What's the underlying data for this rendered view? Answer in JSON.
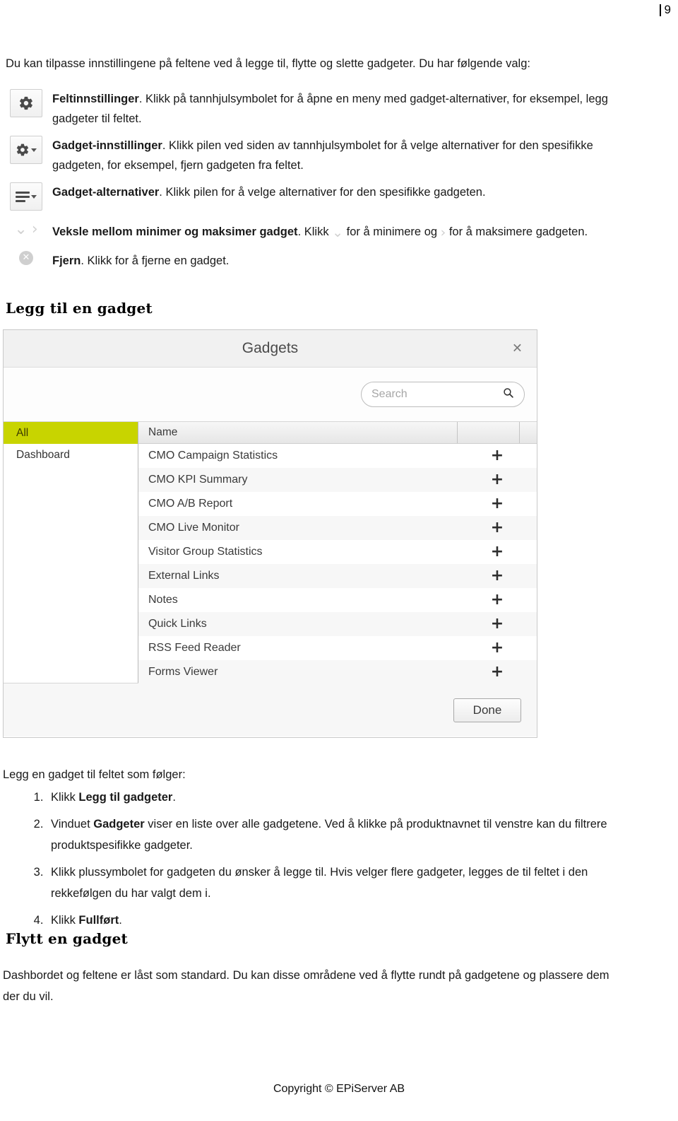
{
  "page": {
    "number": "9",
    "footer": "Copyright © EPiServer AB"
  },
  "intro": "Du kan tilpasse innstillingene på feltene ved å legge til, flytte og slette gadgeter. Du har følgende valg:",
  "bullets": [
    {
      "icon": "gear-icon",
      "term": "Feltinnstillinger",
      "text": ". Klikk på tannhjulsymbolet for å åpne en meny med gadget-alternativer, for eksempel, legg gadgeter til feltet."
    },
    {
      "icon": "gear-dropdown-icon",
      "term": "Gadget-innstillinger",
      "text": ". Klikk pilen ved siden av tannhjulsymbolet for å velge alternativer for den spesifikke gadgeten, for eksempel, fjern gadgeten fra feltet."
    },
    {
      "icon": "list-dropdown-icon",
      "term": "Gadget-alternativer",
      "text": ". Klikk pilen for å velge alternativer for den spesifikke gadgeten."
    },
    {
      "icon": "chevron-toggle-icon",
      "term": "Veksle mellom minimer og maksimer gadget",
      "text_before": ". Klikk ",
      "text_middle": " for å minimere og ",
      "text_after": " for å maksimere gadgeten."
    },
    {
      "icon": "remove-circle-icon",
      "term": "Fjern",
      "text": ". Klikk for å fjerne en gadget."
    }
  ],
  "headings": {
    "add_gadget": "Legg til en gadget",
    "move_gadget": "Flytt en gadget"
  },
  "dialog": {
    "title": "Gadgets",
    "close_label": "✕",
    "search": {
      "placeholder": "Search",
      "value": ""
    },
    "categories": [
      {
        "label": "All",
        "active": true
      },
      {
        "label": "Dashboard",
        "active": false
      }
    ],
    "columns": {
      "name": "Name"
    },
    "rows": [
      {
        "name": "CMO Campaign Statistics",
        "action": "+"
      },
      {
        "name": "CMO KPI Summary",
        "action": "+"
      },
      {
        "name": "CMO A/B Report",
        "action": "+"
      },
      {
        "name": "CMO Live Monitor",
        "action": "+"
      },
      {
        "name": "Visitor Group Statistics",
        "action": "+"
      },
      {
        "name": "External Links",
        "action": "+"
      },
      {
        "name": "Notes",
        "action": "+"
      },
      {
        "name": "Quick Links",
        "action": "+"
      },
      {
        "name": "RSS Feed Reader",
        "action": "+"
      },
      {
        "name": "Forms Viewer",
        "action": "+"
      }
    ],
    "done_label": "Done",
    "accent_color": "#c8d400"
  },
  "steps_lead": "Legg en gadget til feltet som følger:",
  "steps": [
    {
      "pre": "Klikk ",
      "bold": "Legg til gadgeter",
      "post": "."
    },
    {
      "pre": "Vinduet ",
      "bold": "Gadgeter",
      "post": " viser en liste over alle gadgetene. Ved å klikke på produktnavnet til venstre kan du filtrere produktspesifikke gadgeter."
    },
    {
      "pre": "Klikk plussymbolet for gadgeten du ønsker å legge til. Hvis velger flere gadgeter, legges de til feltet i den rekkefølgen du har valgt dem i.",
      "bold": "",
      "post": ""
    },
    {
      "pre": "Klikk ",
      "bold": "Fullført",
      "post": "."
    }
  ],
  "move_paragraph": "Dashbordet og feltene er låst som standard. Du kan disse områdene ved å flytte rundt på gadgetene og plassere dem der du vil."
}
